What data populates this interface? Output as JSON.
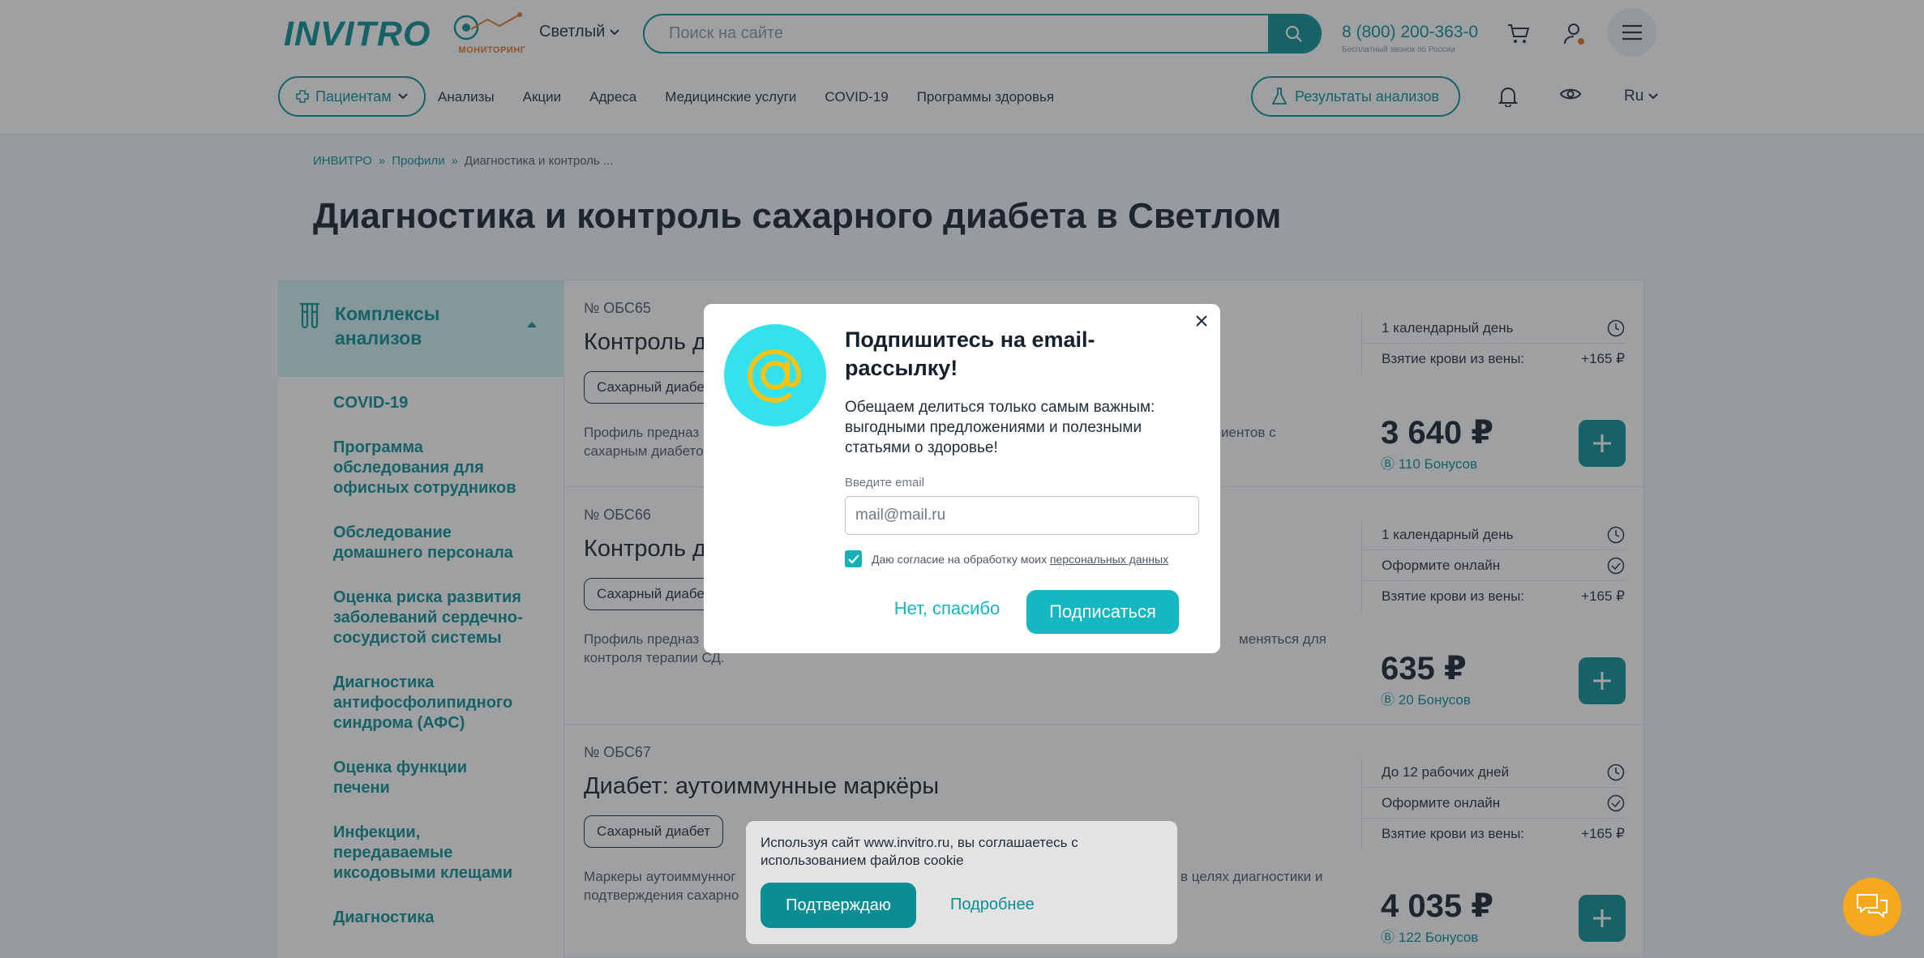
{
  "header": {
    "logo": "INVITRO",
    "monitoring": "МОНИТОРИНГ",
    "city": "Светлый",
    "search_placeholder": "Поиск на сайте",
    "phone": "8 (800) 200-363-0",
    "phone_sub": "Бесплатный звонок по России"
  },
  "nav": {
    "patients": "Пациентам",
    "links": [
      "Анализы",
      "Акции",
      "Адреса",
      "Медицинские услуги",
      "COVID-19",
      "Программы здоровья"
    ],
    "results": "Результаты анализов",
    "lang": "Ru"
  },
  "breadcrumbs": [
    "ИНВИТРО",
    "Профили",
    "Диагностика и контроль ..."
  ],
  "page_title": "Диагностика и контроль сахарного диабета в Светлом",
  "sidebar": {
    "heading": "Комплексы анализов",
    "items": [
      "COVID-19",
      "Программа обследования для офисных сотрудников",
      "Обследование домашнего персонала",
      "Оценка риска развития заболеваний сердечно-сосудистой системы",
      "Диагностика антифосфолипидного синдрома (АФС)",
      "Оценка функции печени",
      "Инфекции, передаваемые иксодовыми клещами",
      "Диагностика"
    ]
  },
  "cards": [
    {
      "num": "№ ОБС65",
      "title": "Контроль д",
      "tag": "Сахарный диабе",
      "desc_left": "Профиль предназ",
      "desc_left2": "сахарным диабето",
      "desc_right": "иентов с",
      "term": "1 календарный день",
      "blood": "Взятие крови из вены:",
      "blood_price": "+165 ₽",
      "price": "3 640 ₽",
      "bonus": "110 Бонусов"
    },
    {
      "num": "№ ОБС66",
      "title": "Контроль д",
      "tag": "Сахарный диабе",
      "desc_left": "Профиль предназ",
      "desc_left2": "контроля терапии СД.",
      "desc_right": "меняться для",
      "term": "1 календарный день",
      "online": "Оформите онлайн",
      "blood": "Взятие крови из вены:",
      "blood_price": "+165 ₽",
      "price": "635 ₽",
      "bonus": "20 Бонусов"
    },
    {
      "num": "№ ОБС67",
      "title": "Диабет: аутоиммунные маркёры",
      "tag": "Сахарный диабет",
      "desc_left": "Маркеры аутоиммунног",
      "desc_left2": "подтверждения сахарно",
      "desc_right": "в целях диагностики и",
      "term": "До 12 рабочих дней",
      "online": "Оформите онлайн",
      "blood": "Взятие крови из вены:",
      "blood_price": "+165 ₽",
      "price": "4 035 ₽",
      "bonus": "122 Бонусов"
    }
  ],
  "modal": {
    "title": "Подпишитесь на email-рассылку!",
    "text": "Обещаем делиться только самым важным: выгодными предложениями и полезными статьями о здоровье!",
    "email_label": "Введите email",
    "email_placeholder": "mail@mail.ru",
    "consent": "Даю согласие на обработку моих",
    "consent_link": "персональных данных",
    "no_thanks": "Нет, спасибо",
    "subscribe": "Подписаться"
  },
  "cookie": {
    "text": "Используя сайт www.invitro.ru, вы соглашаетесь с использованием файлов cookie",
    "confirm": "Подтверждаю",
    "more": "Подробнее"
  },
  "colors": {
    "accent": "#0a8e93",
    "modal_button": "#15b8c0",
    "chat": "#f7a91d"
  }
}
